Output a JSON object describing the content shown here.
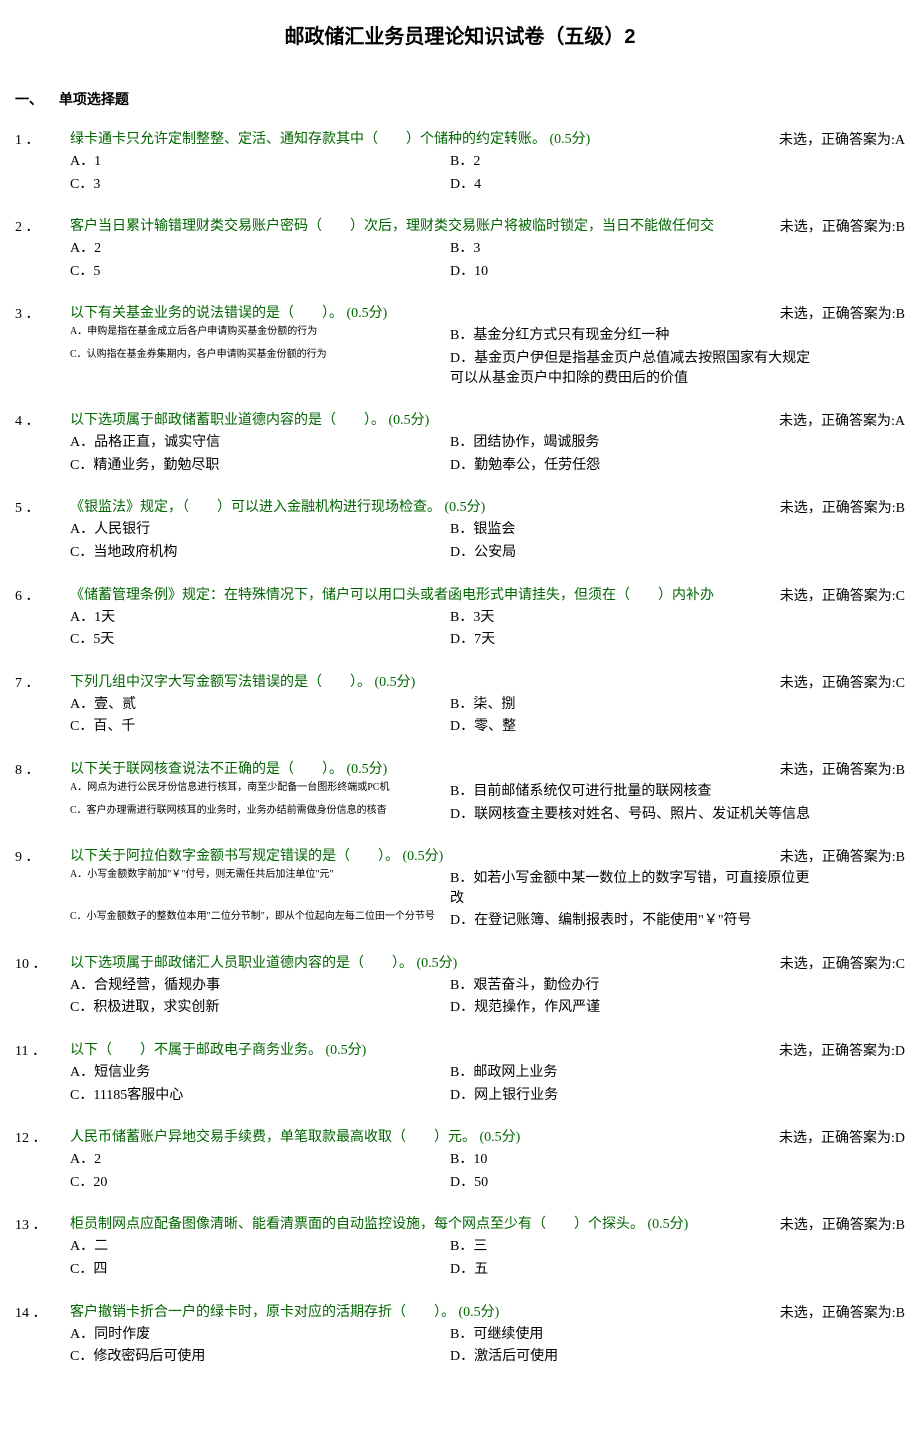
{
  "title": "邮政储汇业务员理论知识试卷（五级）2",
  "section": {
    "num": "一、",
    "name": "单项选择题"
  },
  "status_prefix": "未选，正确答案为:",
  "questions": [
    {
      "num": "1 ．",
      "stem": "绿卡通卡只允许定制整整、定活、通知存款其中（　　）个储种的约定转账。 (0.5分)",
      "answer": "A",
      "opts": [
        {
          "l": "A．",
          "t": "1"
        },
        {
          "l": "B．",
          "t": "2"
        },
        {
          "l": "C．",
          "t": "3"
        },
        {
          "l": "D．",
          "t": "4"
        }
      ]
    },
    {
      "num": "2 ．",
      "stem": "客户当日累计输错理财类交易账户密码（　　）次后，理财类交易账户将被临时锁定，当日不能做任何交",
      "answer": "B",
      "opts": [
        {
          "l": "A．",
          "t": "2"
        },
        {
          "l": "B．",
          "t": "3"
        },
        {
          "l": "C．",
          "t": "5"
        },
        {
          "l": "D．",
          "t": "10"
        }
      ]
    },
    {
      "num": "3 ．",
      "stem": "以下有关基金业务的说法错误的是（　　）。 (0.5分)",
      "answer": "B",
      "small": true,
      "opts": [
        {
          "l": "A．",
          "t": "申购是指在基金成立后各户申请购买基金份额的行为"
        },
        {
          "l": "B．",
          "t": "基金分红方式只有现金分红一种"
        },
        {
          "l": "C．",
          "t": "认购指在基金券集期内，各户申请购买基金份额的行为"
        },
        {
          "l": "D．",
          "t": "基金页户伊但是指基金页户总值减去按照国家有大规定可以从基金页户中扣除的费田后的价值"
        }
      ]
    },
    {
      "num": "4 ．",
      "stem": "以下选项属于邮政储蓄职业道德内容的是（　　）。 (0.5分)",
      "answer": "A",
      "opts": [
        {
          "l": "A．",
          "t": "品格正直，诚实守信"
        },
        {
          "l": "B．",
          "t": "团结协作，竭诚服务"
        },
        {
          "l": "C．",
          "t": "精通业务，勤勉尽职"
        },
        {
          "l": "D．",
          "t": "勤勉奉公，任劳任怨"
        }
      ]
    },
    {
      "num": "5 ．",
      "stem": "《银监法》规定，（　　）可以进入金融机构进行现场检查。 (0.5分)",
      "answer": "B",
      "opts": [
        {
          "l": "A．",
          "t": "人民银行"
        },
        {
          "l": "B．",
          "t": "银监会"
        },
        {
          "l": "C．",
          "t": "当地政府机构"
        },
        {
          "l": "D．",
          "t": "公安局"
        }
      ]
    },
    {
      "num": "6 ．",
      "stem": "《储蓄管理条例》规定：在特殊情况下，储户可以用口头或者函电形式申请挂失，但须在（　　）内补办",
      "answer": "C",
      "opts": [
        {
          "l": "A．",
          "t": "1天"
        },
        {
          "l": "B．",
          "t": "3天"
        },
        {
          "l": "C．",
          "t": "5天"
        },
        {
          "l": "D．",
          "t": "7天"
        }
      ]
    },
    {
      "num": "7 ．",
      "stem": "下列几组中汉字大写金额写法错误的是（　　）。 (0.5分)",
      "answer": "C",
      "opts": [
        {
          "l": "A．",
          "t": "壹、贰"
        },
        {
          "l": "B．",
          "t": "柒、捌"
        },
        {
          "l": "C．",
          "t": "百、千"
        },
        {
          "l": "D．",
          "t": "零、整"
        }
      ]
    },
    {
      "num": "8 ．",
      "stem": "以下关于联网核查说法不正确的是（　　）。 (0.5分)",
      "answer": "B",
      "small": true,
      "opts": [
        {
          "l": "A．",
          "t": "网点为进行公民牙份信息进行核耳，南至少配备一台图形终端或PC机"
        },
        {
          "l": "B．",
          "t": "目前邮储系统仅可进行批量的联网核查"
        },
        {
          "l": "C．",
          "t": "客户办理需进行联网核耳的业务时，业务办结前需做身份信息的核杳"
        },
        {
          "l": "D．",
          "t": "联网核查主要核对姓名、号码、照片、发证机关等信息"
        }
      ]
    },
    {
      "num": "9 ．",
      "stem": "以下关于阿拉伯数字金额书写规定错误的是（　　）。 (0.5分)",
      "answer": "B",
      "small": true,
      "opts": [
        {
          "l": "A．",
          "t": "小写金额数字前加\"￥\"付号，则无需任共后加注单位\"元\""
        },
        {
          "l": "B．",
          "t": "如若小写金额中某一数位上的数字写错，可直接原位更改"
        },
        {
          "l": "C．",
          "t": "小写金额数子的整数位本用\"二位分节制\"，即从个位起向左每二位田一个分节号"
        },
        {
          "l": "D．",
          "t": "在登记账簿、编制报表时，不能使用\"￥\"符号"
        }
      ]
    },
    {
      "num": "10 ．",
      "stem": "以下选项属于邮政储汇人员职业道德内容的是（　　）。 (0.5分)",
      "answer": "C",
      "opts": [
        {
          "l": "A．",
          "t": "合规经营，循规办事"
        },
        {
          "l": "B．",
          "t": "艰苦奋斗，勤俭办行"
        },
        {
          "l": "C．",
          "t": "积极进取，求实创新"
        },
        {
          "l": "D．",
          "t": "规范操作，作风严谨"
        }
      ]
    },
    {
      "num": "11 ．",
      "stem": "以下（　　）不属于邮政电子商务业务。 (0.5分)",
      "answer": "D",
      "opts": [
        {
          "l": "A．",
          "t": "短信业务"
        },
        {
          "l": "B．",
          "t": "邮政网上业务"
        },
        {
          "l": "C．",
          "t": "11185客服中心"
        },
        {
          "l": "D．",
          "t": "网上银行业务"
        }
      ]
    },
    {
      "num": "12 ．",
      "stem": "人民币储蓄账户异地交易手续费，单笔取款最高收取（　　）元。 (0.5分)",
      "answer": "D",
      "opts": [
        {
          "l": "A．",
          "t": "2"
        },
        {
          "l": "B．",
          "t": "10"
        },
        {
          "l": "C．",
          "t": "20"
        },
        {
          "l": "D．",
          "t": "50"
        }
      ]
    },
    {
      "num": "13 ．",
      "stem": "柜员制网点应配备图像清晰、能看清票面的自动监控设施，每个网点至少有（　　）个探头。 (0.5分)",
      "answer": "B",
      "opts": [
        {
          "l": "A．",
          "t": "二"
        },
        {
          "l": "B．",
          "t": "三"
        },
        {
          "l": "C．",
          "t": "四"
        },
        {
          "l": "D．",
          "t": "五"
        }
      ]
    },
    {
      "num": "14 ．",
      "stem": "客户撤销卡折合一户的绿卡时，原卡对应的活期存折（　　）。 (0.5分)",
      "answer": "B",
      "opts": [
        {
          "l": "A．",
          "t": "同时作废"
        },
        {
          "l": "B．",
          "t": "可继续使用"
        },
        {
          "l": "C．",
          "t": "修改密码后可使用"
        },
        {
          "l": "D．",
          "t": "激活后可使用"
        }
      ]
    }
  ]
}
